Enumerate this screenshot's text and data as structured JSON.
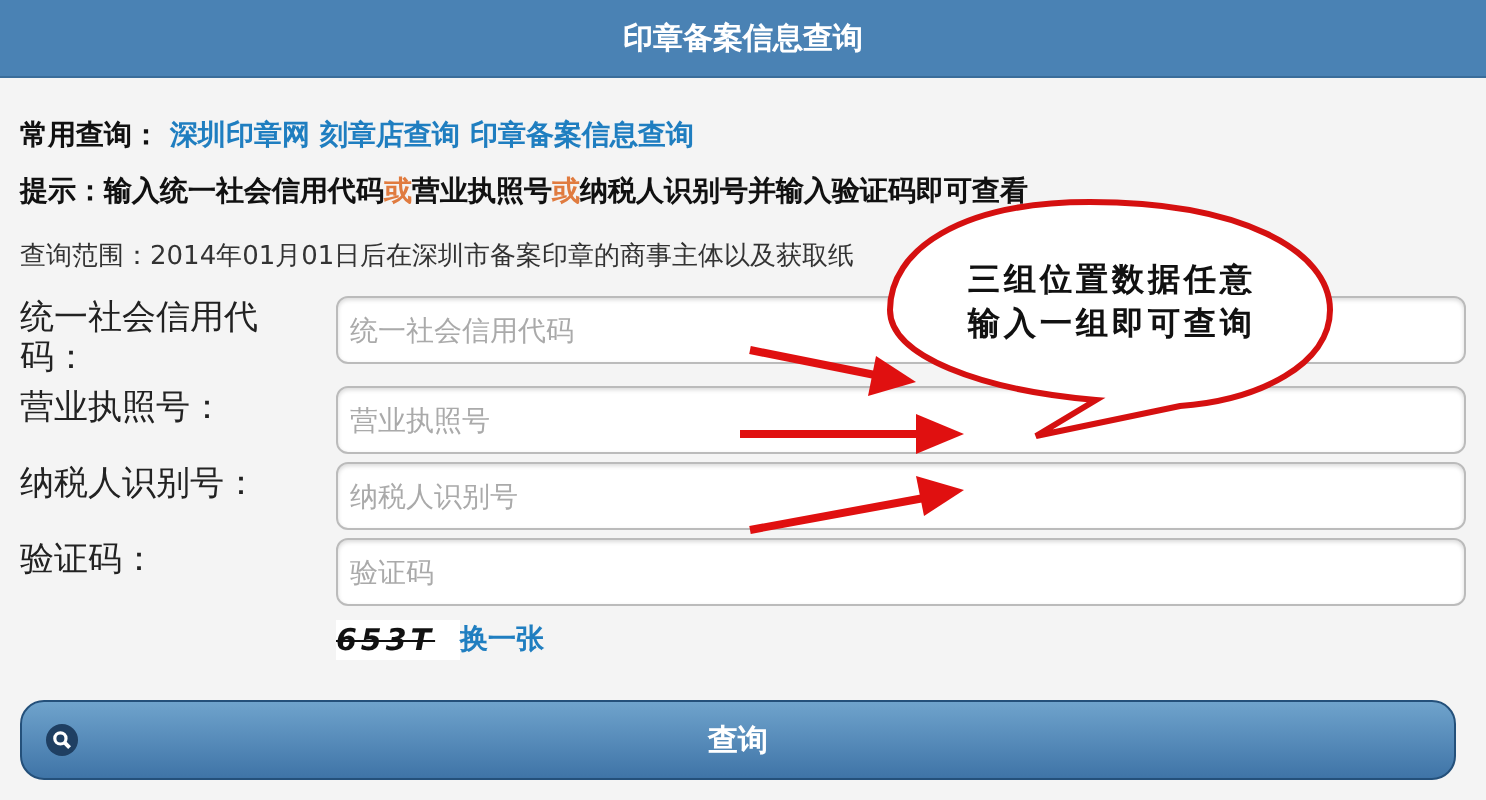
{
  "header": {
    "title": "印章备案信息查询"
  },
  "common_links": {
    "label": "常用查询：",
    "links": [
      "深圳印章网",
      "刻章店查询",
      "印章备案信息查询"
    ]
  },
  "hint": "提示：输入统一社会信用代码**或**营业执照号**或**纳税人识别号并输入验证码即可查看",
  "scope": "查询范围：2014年01月01日后在深圳市备案印章的商事主体以及获取纸",
  "fields": [
    {
      "label": "统一社会信用代码：",
      "placeholder": "统一社会信用代码"
    },
    {
      "label": "营业执照号：",
      "placeholder": "营业执照号"
    },
    {
      "label": "纳税人识别号：",
      "placeholder": "纳税人识别号"
    },
    {
      "label": "验证码：",
      "placeholder": "验证码"
    }
  ],
  "captcha": {
    "text": "653T",
    "refresh_link": "换一张"
  },
  "submit_button": "查询",
  "callout": {
    "lines": [
      "三组位置数据任意",
      "输入一组即可查询"
    ]
  }
}
